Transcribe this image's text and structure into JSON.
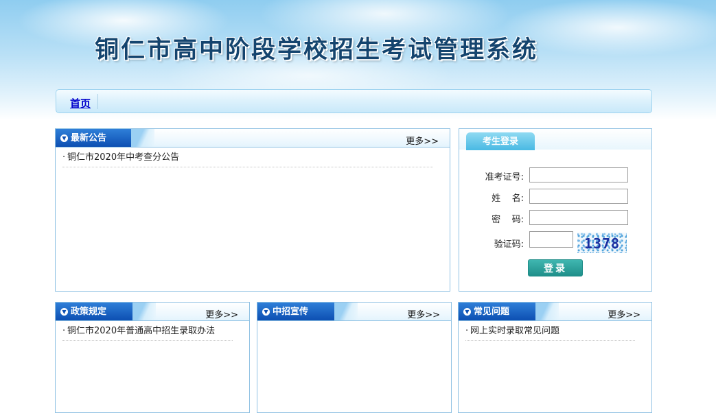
{
  "site": {
    "title": "铜仁市高中阶段学校招生考试管理系统"
  },
  "nav": {
    "home": "首页"
  },
  "panels": {
    "announcements": {
      "title": "最新公告",
      "more": "更多>>",
      "items": [
        "铜仁市2020年中考查分公告"
      ]
    },
    "policy": {
      "title": "政策规定",
      "more": "更多>>",
      "items": [
        "铜仁市2020年普通高中招生录取办法"
      ]
    },
    "promotion": {
      "title": "中招宣传",
      "more": "更多>>",
      "items": []
    },
    "faq": {
      "title": "常见问题",
      "more": "更多>>",
      "items": [
        "网上实时录取常见问题"
      ]
    }
  },
  "login": {
    "tab_title": "考生登录",
    "exam_no_label": "准考证号:",
    "name_label": "姓    名:",
    "password_label": "密    码:",
    "captcha_label": "验证码:",
    "captcha_value": "1378",
    "submit_label": "登录",
    "exam_no_value": "",
    "name_value": "",
    "password_value": "",
    "captcha_input_value": ""
  },
  "colors": {
    "tab_blue": "#0d4fb2",
    "login_button": "#1f8f8a",
    "title_text": "#14446e",
    "link": "#0000cc"
  }
}
